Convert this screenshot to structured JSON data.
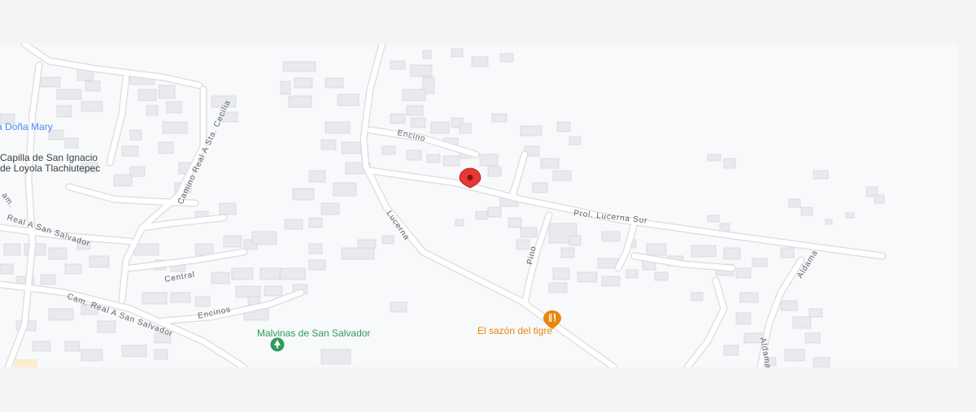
{
  "map": {
    "colors": {
      "background": "#f8f9fa",
      "road": "#ffffff",
      "road_casing": "#dadce0",
      "building": "#e8eaed",
      "building_stroke": "#d2d5da",
      "marker": "#e53935",
      "restaurant": "#e8860f",
      "park": "#2e9b5a",
      "place_link": "#4a8af4",
      "place_text": "#3c4043"
    },
    "roads": {
      "encino": "Encino",
      "prol_lucerna_sur": "Prol. Lucerna Sur",
      "lucerna": "Lucerna",
      "pino": "Pino",
      "camino_real_sta_cecilia": "Camino Real A Sta. Cecilia",
      "real_san_salvador_left": "Real A San Salvador",
      "central": "Central",
      "cam_real_san_salvador": "Cam. Real A San Salvador",
      "encinos": "Encinos",
      "aldama_upper": "Aldama",
      "aldama_lower": "Aldama"
    },
    "places": {
      "dona_mary": "a Doña Mary",
      "capilla_line1": "Capilla de San Ignacio",
      "capilla_line2": "de Loyola Tlachiutepec",
      "malvinas": "Malvinas de San Salvador",
      "sazon": "El sazón del tigre"
    },
    "icons": {
      "marker": "location-pin-icon",
      "restaurant": "restaurant-icon",
      "park": "park-icon"
    }
  }
}
